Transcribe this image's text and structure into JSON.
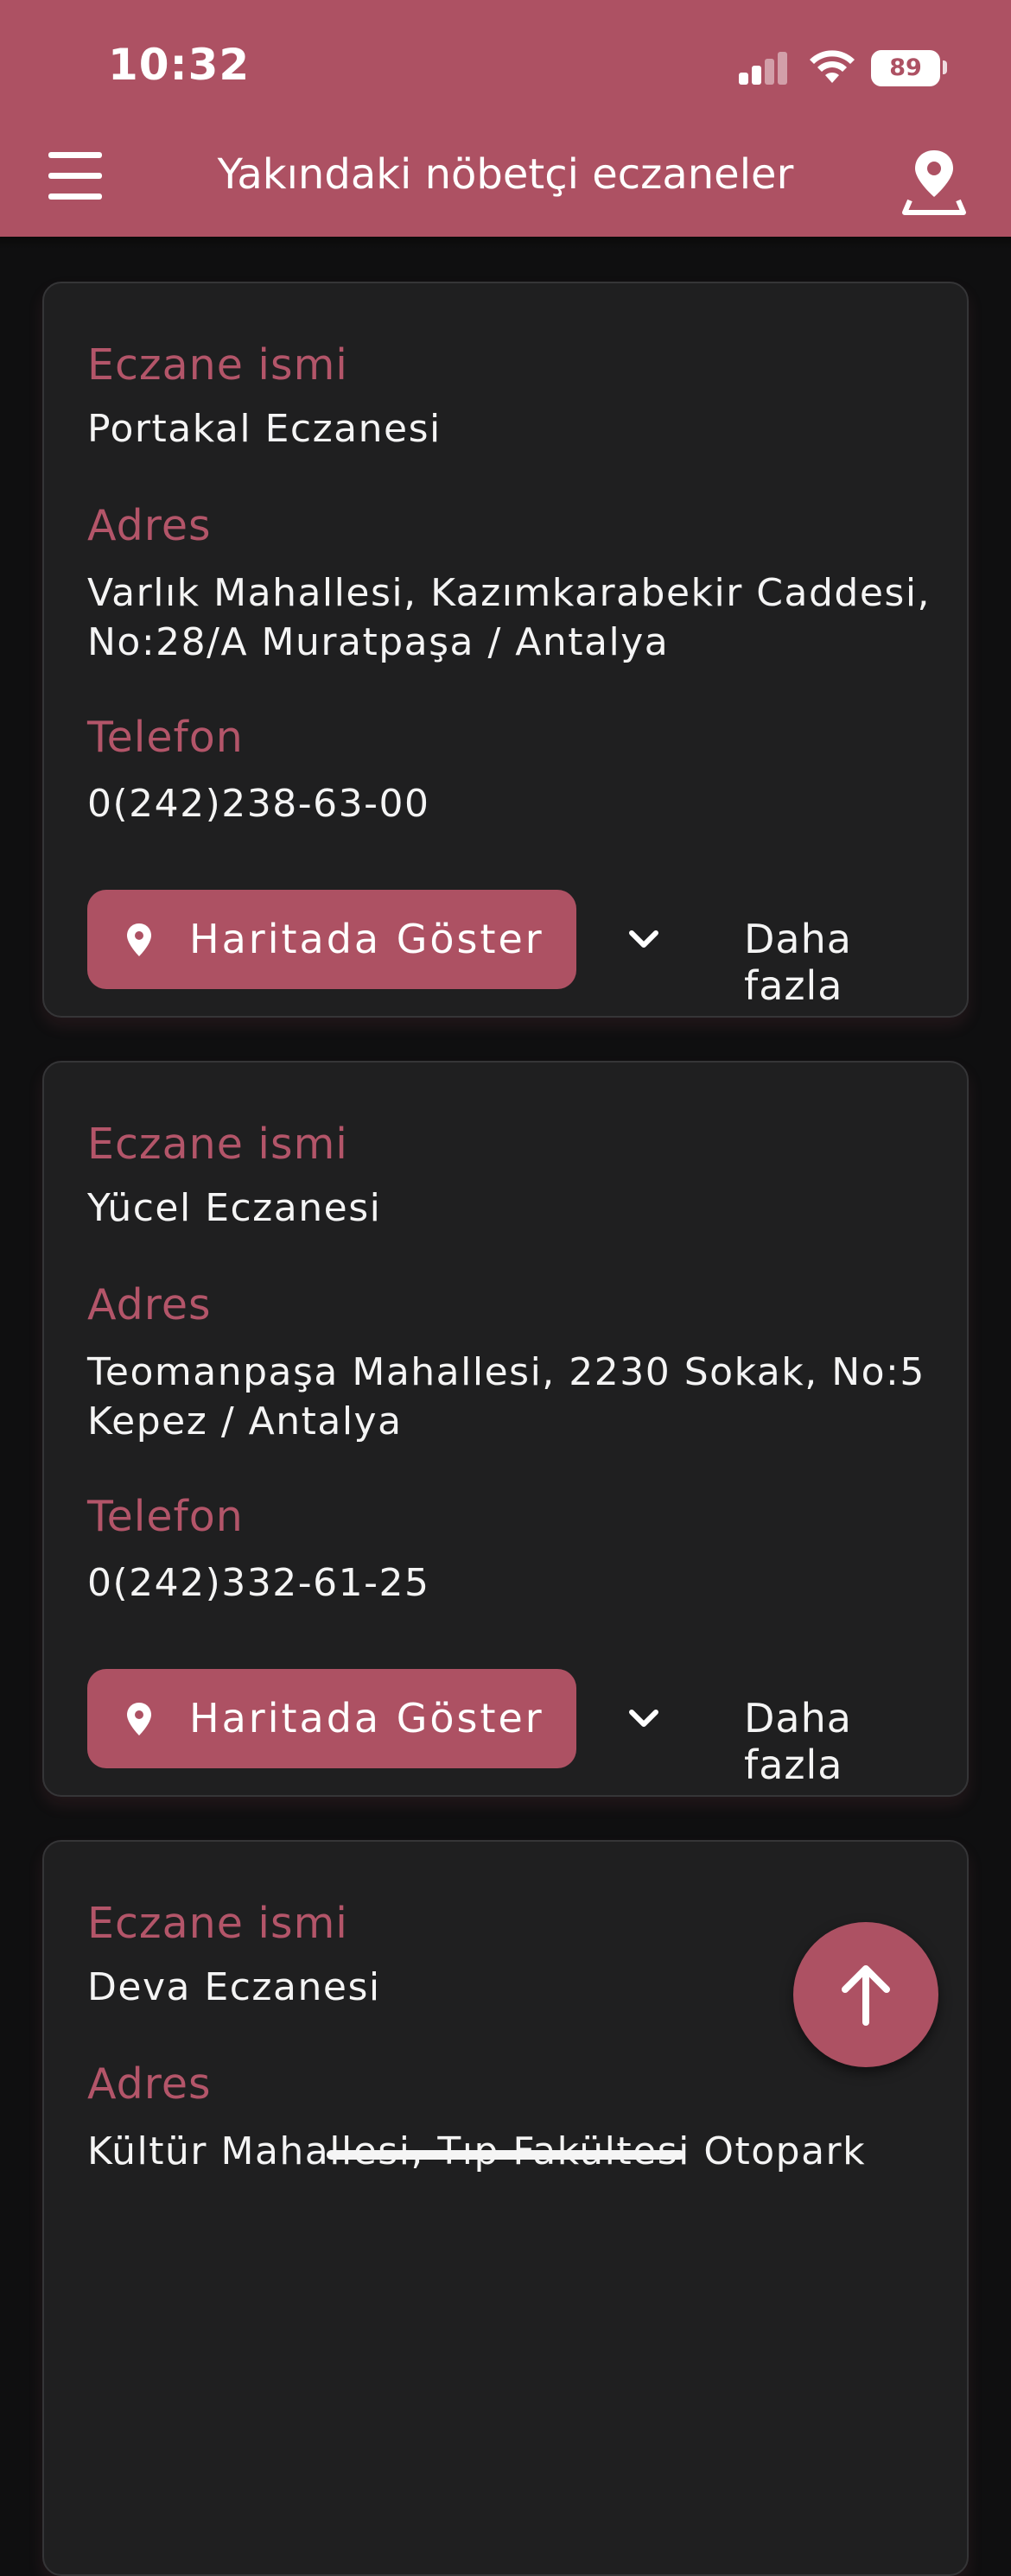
{
  "status_bar": {
    "time": "10:32",
    "battery": "89"
  },
  "header": {
    "title": "Yakındaki nöbetçi eczaneler"
  },
  "icons": {
    "menu": "menu-icon",
    "location": "location-pin-icon",
    "map_pin": "map-pin-icon",
    "chevron": "chevron-down-icon",
    "scroll_top": "arrow-up-icon"
  },
  "colors": {
    "accent": "#ad5163",
    "card_bg": "#1f1f20",
    "page_bg": "#0f0f10"
  },
  "labels": {
    "name": "Eczane ismi",
    "address": "Adres",
    "phone": "Telefon",
    "show_on_map": "Haritada Göster",
    "more": "Daha fazla"
  },
  "pharmacies": [
    {
      "name": "Portakal Eczanesi",
      "address_line1": "Varlık Mahallesi, Kazımkarabekir Caddesi,",
      "address_line2": "No:28/A Muratpaşa / Antalya",
      "phone": "0(242)238-63-00"
    },
    {
      "name": "Yücel Eczanesi",
      "address_line1": "Teomanpaşa Mahallesi, 2230 Sokak, No:5",
      "address_line2": "Kepez / Antalya",
      "phone": "0(242)332-61-25"
    },
    {
      "name": "Deva Eczanesi",
      "address_line1": "Kültür Mahallesi, Tıp Fakültesi Otopark"
    }
  ]
}
